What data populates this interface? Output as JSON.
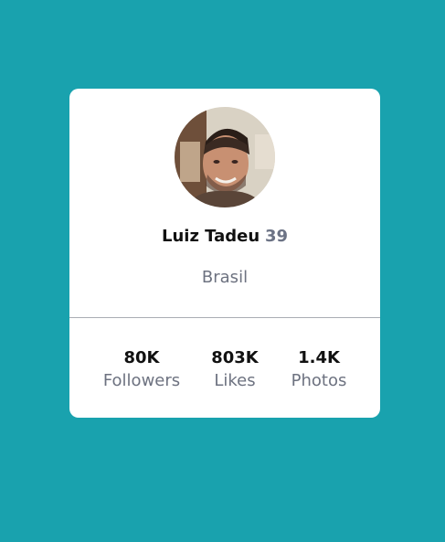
{
  "profile": {
    "name": "Luiz Tadeu",
    "age": "39",
    "country": "Brasil",
    "avatar": "avatar-photo"
  },
  "stats": [
    {
      "value": "80K",
      "label": "Followers"
    },
    {
      "value": "803K",
      "label": "Likes"
    },
    {
      "value": "1.4K",
      "label": "Photos"
    }
  ],
  "colors": {
    "background": "#19a2ae",
    "card": "#ffffff",
    "muted_text": "#6d7280",
    "primary_text": "#111111"
  }
}
